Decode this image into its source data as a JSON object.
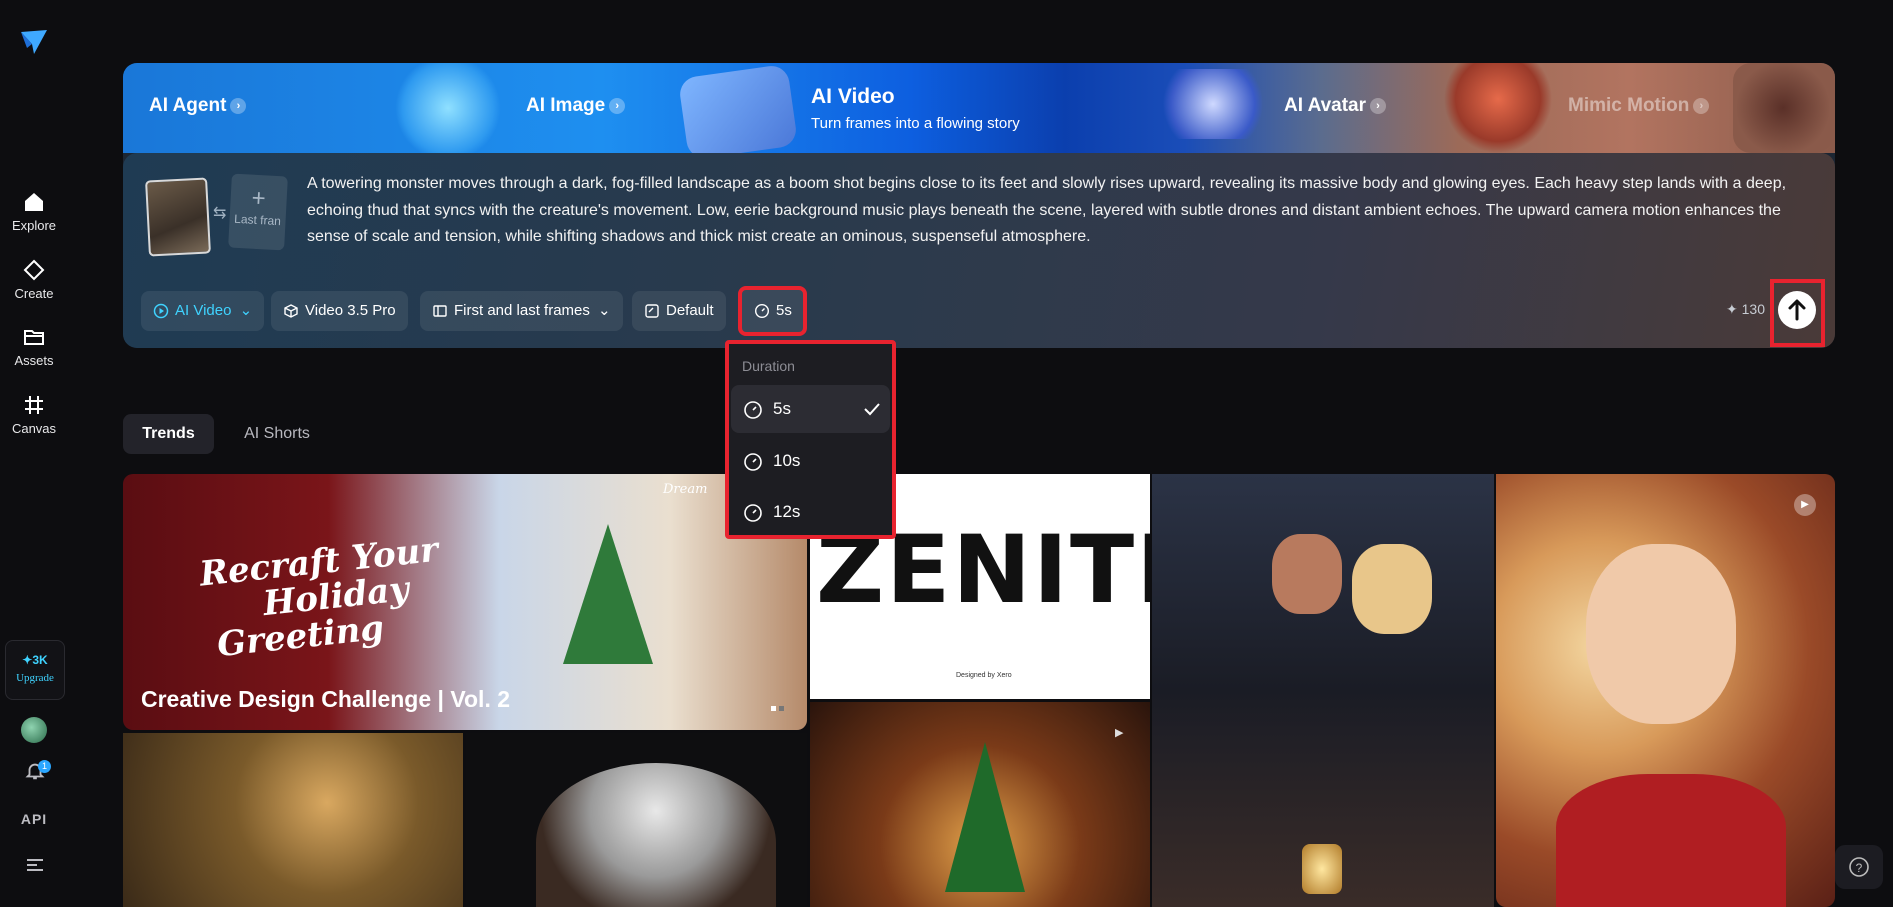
{
  "sidebar": {
    "nav": [
      {
        "label": "Explore",
        "icon": "home-icon"
      },
      {
        "label": "Create",
        "icon": "diamond-icon"
      },
      {
        "label": "Assets",
        "icon": "folder-icon"
      },
      {
        "label": "Canvas",
        "icon": "canvas-icon"
      }
    ],
    "credits": "✦3K",
    "upgrade_label": "Upgrade",
    "notification_count": "1",
    "api_label": "API"
  },
  "hero": {
    "tabs": [
      {
        "label": "AI Agent"
      },
      {
        "label": "AI Image"
      },
      {
        "label": "AI Avatar"
      },
      {
        "label": "Mimic Motion"
      }
    ],
    "active_tab": {
      "title": "AI Video",
      "subtitle": "Turn frames into a flowing story"
    },
    "last_frame_label": "Last fran",
    "prompt": "A towering monster moves through a dark, fog-filled landscape as a boom shot begins close to its feet and slowly rises upward, revealing its massive body and glowing eyes. Each heavy step lands with a deep, echoing thud that syncs with the creature's movement. Low, eerie background music plays beneath the scene, layered with subtle drones and distant ambient echoes. The upward camera motion enhances the sense of scale and tension, while shifting shadows and thick mist create an ominous, suspenseful atmosphere.",
    "chips": {
      "mode": "AI Video",
      "model": "Video 3.5 Pro",
      "frames": "First and last frames",
      "ratio": "Default",
      "duration": "5s"
    },
    "cost": "✦ 130"
  },
  "duration_menu": {
    "heading": "Duration",
    "options": [
      "5s",
      "10s",
      "12s"
    ],
    "selected": "5s"
  },
  "feed_tabs": [
    "Trends",
    "AI Shorts"
  ],
  "gallery": {
    "featured_title": "Creative Design Challenge | Vol. 2",
    "featured_art_text": [
      "Recraft Your",
      "Holiday",
      "Greeting"
    ],
    "watermark": "Dream",
    "zenith_text": "ZENITH",
    "zenith_credit": "Designed by Xero"
  },
  "colors": {
    "accent": "#3fd3ff",
    "highlight": "#e8232f"
  }
}
